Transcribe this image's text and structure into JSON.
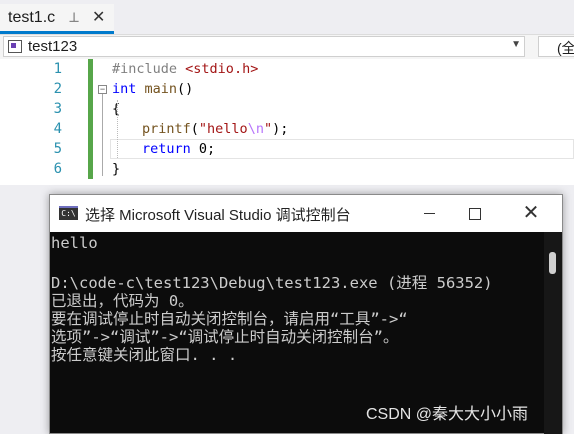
{
  "editor": {
    "tab": {
      "title": "test1.c",
      "pin_glyph": "⊣",
      "close_glyph": "✕"
    },
    "navbar": {
      "scope": "test123",
      "right_scope": "(全"
    },
    "line_numbers": [
      "1",
      "2",
      "3",
      "4",
      "5",
      "6"
    ],
    "code": {
      "l1_directive": "#include",
      "l1_header": "<stdio.h>",
      "l2_type": "int",
      "l2_name": "main",
      "l2_parens": "()",
      "l3": "{",
      "l4_fn": "printf",
      "l4_open": "(",
      "l4_str_a": "\"hello",
      "l4_esc": "\\n",
      "l4_str_b": "\"",
      "l4_close": ");",
      "l5_kw": "return",
      "l5_rest": " 0;",
      "l6": "}"
    }
  },
  "console": {
    "title": "选择 Microsoft Visual Studio 调试控制台",
    "icon_text": "C:\\",
    "lines": [
      "hello",
      "",
      "D:\\code-c\\test123\\Debug\\test123.exe (进程 56352)",
      "已退出，代码为 0。",
      "要在调试停止时自动关闭控制台，请启用“工具”->“",
      "选项”->“调试”->“调试停止时自动关闭控制台”。",
      "按任意键关闭此窗口. . ."
    ]
  },
  "watermark": "CSDN @秦大大小小雨",
  "colors": {
    "accent": "#007acc",
    "keyword": "#0000ff",
    "string": "#a31515",
    "changebar": "#57a64a",
    "console_bg": "#0c0c0c"
  }
}
